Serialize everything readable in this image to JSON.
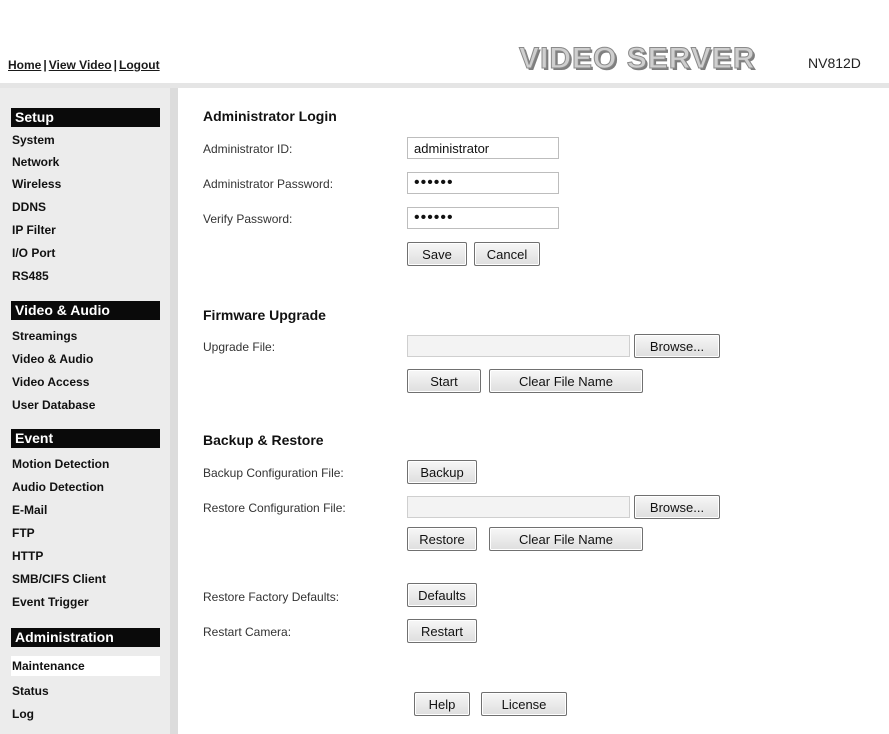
{
  "header": {
    "nav": [
      "Home",
      "View Video",
      "Logout"
    ],
    "brand": "VIDEO SERVER",
    "model": "NV812D"
  },
  "sidebar": {
    "setup": {
      "title": "Setup",
      "items": [
        "System",
        "Network",
        "Wireless",
        "DDNS",
        "IP Filter",
        "I/O Port",
        "RS485"
      ]
    },
    "video_audio": {
      "title": "Video & Audio",
      "items": [
        "Streamings",
        "Video & Audio",
        "Video Access",
        "User Database"
      ]
    },
    "event": {
      "title": "Event",
      "items": [
        "Motion Detection",
        "Audio Detection",
        "E-Mail",
        "FTP",
        "HTTP",
        "SMB/CIFS Client",
        "Event Trigger"
      ]
    },
    "administration": {
      "title": "Administration",
      "items": [
        "Maintenance",
        "Status",
        "Log"
      ],
      "active": "Maintenance"
    }
  },
  "admin_login": {
    "title": "Administrator Login",
    "id_label": "Administrator ID:",
    "id_value": "administrator",
    "password_label": "Administrator Password:",
    "password_value": "••••••",
    "verify_label": "Verify Password:",
    "verify_value": "••••••",
    "save": "Save",
    "cancel": "Cancel"
  },
  "firmware": {
    "title": "Firmware Upgrade",
    "file_label": "Upgrade File:",
    "browse": "Browse...",
    "start": "Start",
    "clear": "Clear File Name"
  },
  "backup": {
    "title": "Backup & Restore",
    "backup_label": "Backup Configuration File:",
    "backup_button": "Backup",
    "restore_label": "Restore Configuration File:",
    "browse": "Browse...",
    "restore_button": "Restore",
    "clear": "Clear File Name",
    "defaults_label": "Restore Factory Defaults:",
    "defaults_button": "Defaults",
    "restart_label": "Restart Camera:",
    "restart_button": "Restart"
  },
  "footer": {
    "help": "Help",
    "license": "License"
  }
}
